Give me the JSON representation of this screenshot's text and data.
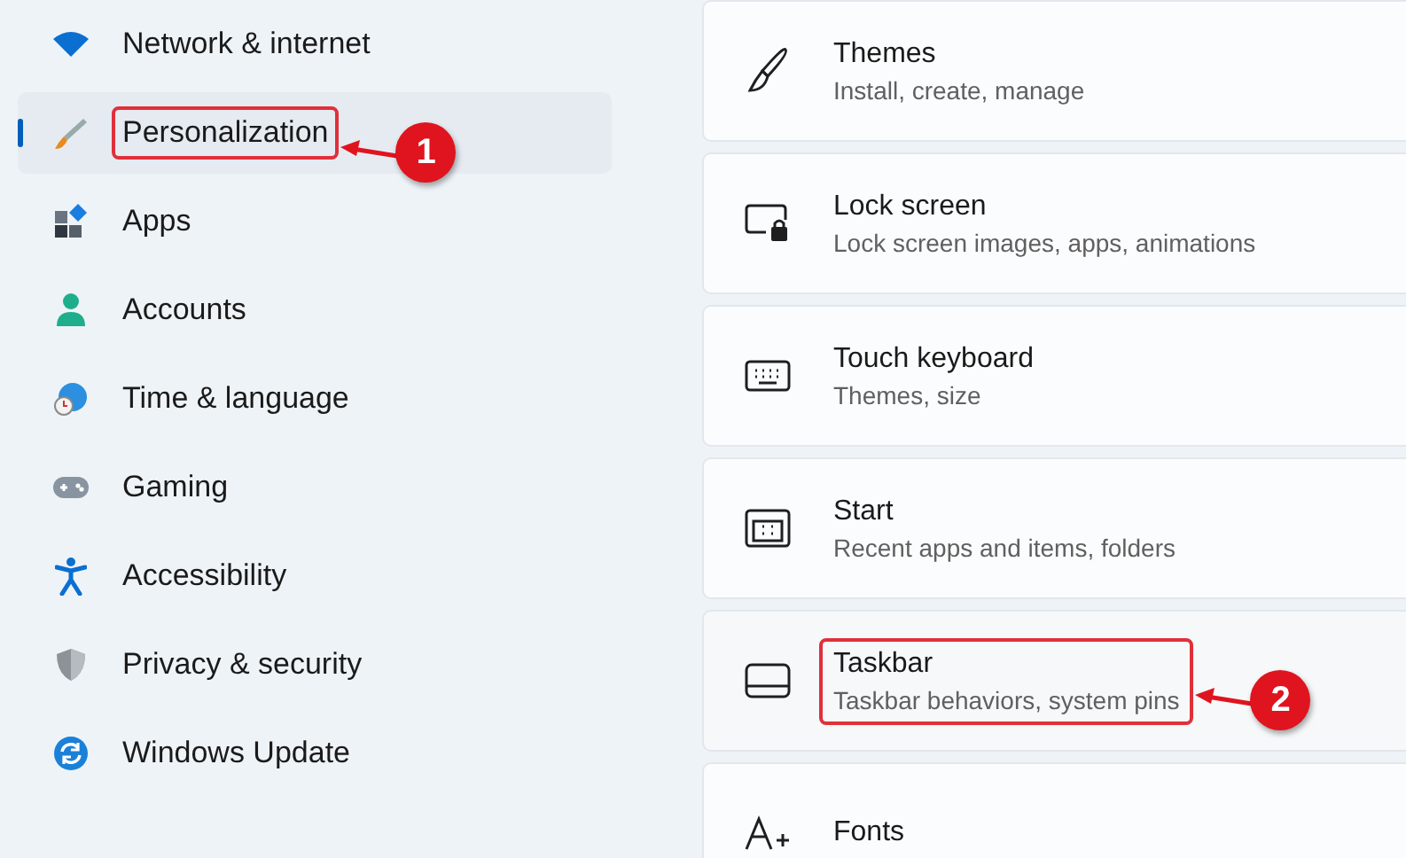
{
  "sidebar": {
    "items": [
      {
        "label": "Network & internet",
        "selected": false,
        "highlighted": false
      },
      {
        "label": "Personalization",
        "selected": true,
        "highlighted": true,
        "callout": "1"
      },
      {
        "label": "Apps",
        "selected": false,
        "highlighted": false
      },
      {
        "label": "Accounts",
        "selected": false,
        "highlighted": false
      },
      {
        "label": "Time & language",
        "selected": false,
        "highlighted": false
      },
      {
        "label": "Gaming",
        "selected": false,
        "highlighted": false
      },
      {
        "label": "Accessibility",
        "selected": false,
        "highlighted": false
      },
      {
        "label": "Privacy & security",
        "selected": false,
        "highlighted": false
      },
      {
        "label": "Windows Update",
        "selected": false,
        "highlighted": false
      }
    ]
  },
  "settings": [
    {
      "title": "Themes",
      "subtitle": "Install, create, manage",
      "highlighted": false
    },
    {
      "title": "Lock screen",
      "subtitle": "Lock screen images, apps, animations",
      "highlighted": false
    },
    {
      "title": "Touch keyboard",
      "subtitle": "Themes, size",
      "highlighted": false
    },
    {
      "title": "Start",
      "subtitle": "Recent apps and items, folders",
      "highlighted": false
    },
    {
      "title": "Taskbar",
      "subtitle": "Taskbar behaviors, system pins",
      "highlighted": true,
      "callout": "2"
    },
    {
      "title": "Fonts",
      "highlighted": false
    }
  ]
}
